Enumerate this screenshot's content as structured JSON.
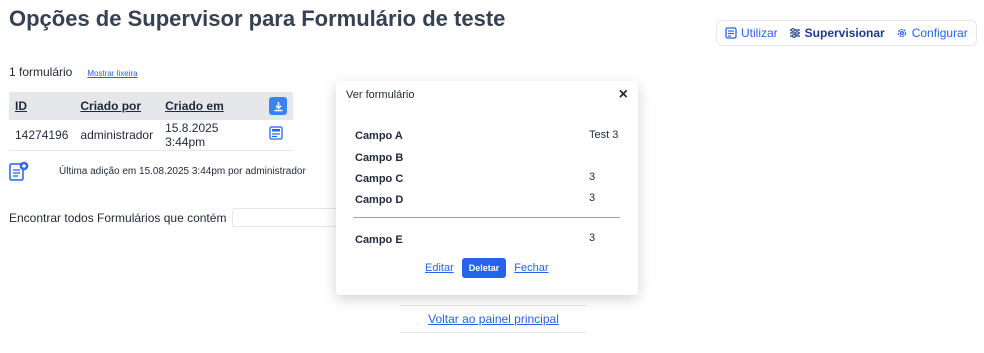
{
  "page": {
    "title": "Opções de Supervisor para Formulário de teste"
  },
  "nav": [
    {
      "label": "Utilizar",
      "icon": "form-icon",
      "active": false
    },
    {
      "label": "Supervisionar",
      "icon": "sliders-icon",
      "active": true
    },
    {
      "label": "Configurar",
      "icon": "gear-icon",
      "active": false
    }
  ],
  "summary": {
    "count_label": "1 formulário",
    "trash_link": "Mostrar lixeira"
  },
  "table": {
    "headers": [
      "ID",
      "Criado por",
      "Criado em"
    ],
    "rows": [
      {
        "id": "14274196",
        "created_by": "administrador",
        "created_at": "15.8.2025 3:44pm"
      }
    ]
  },
  "last_addition": "Última adição em 15.08.2025 3:44pm por administrador",
  "find": {
    "label": "Encontrar todos Formulários que contém",
    "value": ""
  },
  "back_link": "Voltar ao painel principal",
  "modal": {
    "title": "Ver formulário",
    "close": "×",
    "fields": [
      {
        "name": "Campo A",
        "value": "Test 3"
      },
      {
        "name": "Campo B",
        "value": ""
      },
      {
        "name": "Campo C",
        "value": "3"
      },
      {
        "name": "Campo D",
        "value": "3"
      },
      {
        "name": "Campo E",
        "value": "3"
      }
    ],
    "actions": {
      "edit": "Editar",
      "delete": "Deletar",
      "close": "Fechar"
    }
  },
  "colors": {
    "accent": "#2563eb",
    "header_bg": "#e5e7eb"
  }
}
